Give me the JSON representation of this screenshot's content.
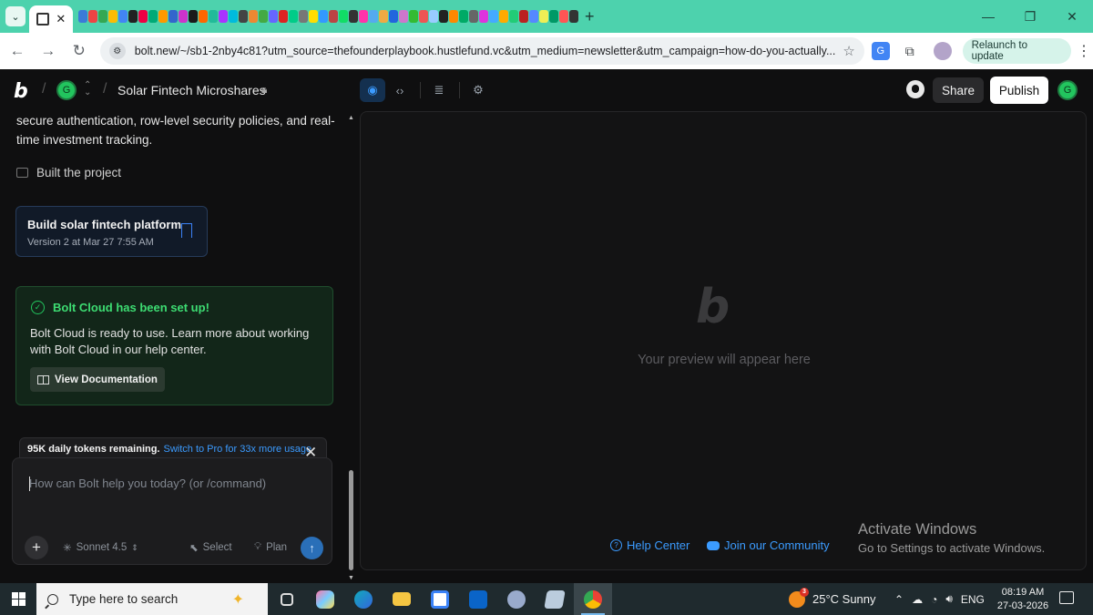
{
  "browser": {
    "url": "bolt.new/~/sb1-2nby4c81?utm_source=thefounderplaybook.hustlefund.vc&utm_medium=newsletter&utm_campaign=how-do-you-actually...",
    "relaunch_label": "Relaunch to update",
    "tab_colors": [
      "#3b7bd8",
      "#e44",
      "#34a853",
      "#fbbc05",
      "#4285f4",
      "#222",
      "#e04",
      "#0a7",
      "#f90",
      "#36c",
      "#c3c",
      "#1a1a1a",
      "#f60",
      "#2b9",
      "#a3f",
      "#0bd",
      "#444",
      "#e83",
      "#4a4",
      "#66f",
      "#d22",
      "#0c8",
      "#777",
      "#fd0",
      "#39f",
      "#b44",
      "#1d6",
      "#333",
      "#f3a",
      "#5ae",
      "#ea4",
      "#26d",
      "#c7c",
      "#3b3",
      "#e55",
      "#9cf",
      "#222",
      "#f80",
      "#0a6",
      "#666",
      "#d3d",
      "#4af",
      "#fa0",
      "#2c7",
      "#b22",
      "#58f",
      "#ee5",
      "#096",
      "#f55",
      "#333"
    ]
  },
  "header": {
    "logo": "b",
    "avatar_initial": "G",
    "project_title": "Solar Fintech Microshares",
    "share_label": "Share",
    "publish_label": "Publish",
    "user_initial": "G"
  },
  "chat": {
    "message_text": "secure authentication, row-level security policies, and real-time investment tracking.",
    "built_label": "Built the project",
    "version_card": {
      "title": "Build solar fintech platform",
      "subtitle": "Version 2 at Mar 27 7:55 AM"
    },
    "cloud_card": {
      "title": "Bolt Cloud has been set up!",
      "body": "Bolt Cloud is ready to use. Learn more about working with Bolt Cloud in our help center.",
      "button_label": "View Documentation"
    },
    "tokens": {
      "remaining": "95K daily tokens remaining.",
      "upgrade": "Switch to Pro for 33x more usage"
    },
    "composer": {
      "placeholder": "How can Bolt help you today? (or /command)",
      "model_label": "Sonnet 4.5",
      "select_label": "Select",
      "plan_label": "Plan"
    }
  },
  "preview": {
    "logo": "b",
    "empty_text": "Your preview will appear here",
    "help_center": "Help Center",
    "community": "Join our Community"
  },
  "watermark": {
    "title": "Activate Windows",
    "subtitle": "Go to Settings to activate Windows."
  },
  "taskbar": {
    "search_placeholder": "Type here to search",
    "weather_badge": "3",
    "weather": "25°C  Sunny",
    "language": "ENG",
    "time": "08:19 AM",
    "date": "27-03-2026"
  }
}
